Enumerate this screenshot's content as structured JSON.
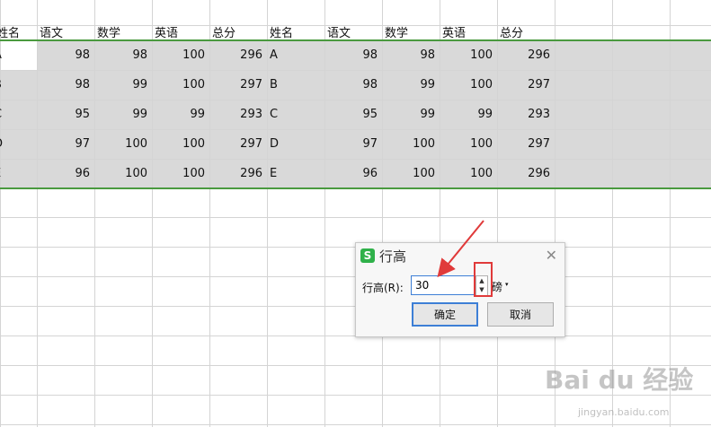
{
  "sheet": {
    "headers": [
      "姓名",
      "语文",
      "数学",
      "英语",
      "总分",
      "姓名",
      "语文",
      "数学",
      "英语",
      "总分"
    ],
    "rows": [
      [
        "A",
        "98",
        "98",
        "100",
        "296",
        "A",
        "98",
        "98",
        "100",
        "296"
      ],
      [
        "B",
        "98",
        "99",
        "100",
        "297",
        "B",
        "98",
        "99",
        "100",
        "297"
      ],
      [
        "C",
        "95",
        "99",
        "99",
        "293",
        "C",
        "95",
        "99",
        "99",
        "293"
      ],
      [
        "D",
        "97",
        "100",
        "100",
        "297",
        "D",
        "97",
        "100",
        "100",
        "297"
      ],
      [
        "E",
        "96",
        "100",
        "100",
        "296",
        "E",
        "96",
        "100",
        "100",
        "296"
      ]
    ]
  },
  "dialog": {
    "icon_letter": "S",
    "title": "行高",
    "close": "✕",
    "label": "行高(R):",
    "value": "30",
    "unit": "磅",
    "unit_arrow": "▾",
    "spin_up": "▲",
    "spin_down": "▼",
    "ok": "确定",
    "cancel": "取消"
  },
  "watermark": {
    "main": "Bai du 经验",
    "sub": "jingyan.baidu.com"
  },
  "colors": {
    "selection_fill": "#d9d9d9",
    "selection_border": "#4a9a3f",
    "annotation": "#e03a3a",
    "wps_icon": "#2fb14a"
  }
}
